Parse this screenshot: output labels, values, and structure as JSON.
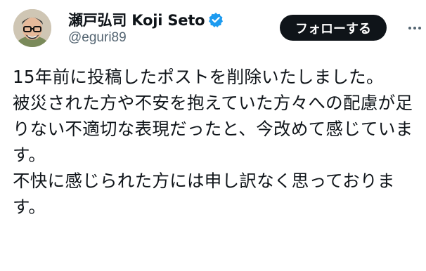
{
  "author": {
    "display_name": "瀬戸弘司 Koji Seto",
    "handle": "@eguri89",
    "verified": true,
    "avatar_icon": "avatar-photo"
  },
  "follow_button": {
    "label": "フォローする"
  },
  "more_menu": {
    "icon": "more-horizontal-icon"
  },
  "tweet": {
    "paragraphs": [
      "15年前に投稿したポストを削除いたしました。",
      "被災された方や不安を抱えていた方々への配慮が足りない不適切な表現だったと、今改めて感じています。",
      "不快に感じられた方には申し訳なく思っております。"
    ]
  },
  "colors": {
    "verified_badge": "#1d9bf0",
    "button_bg": "#0f1419",
    "handle_text": "#536471"
  }
}
